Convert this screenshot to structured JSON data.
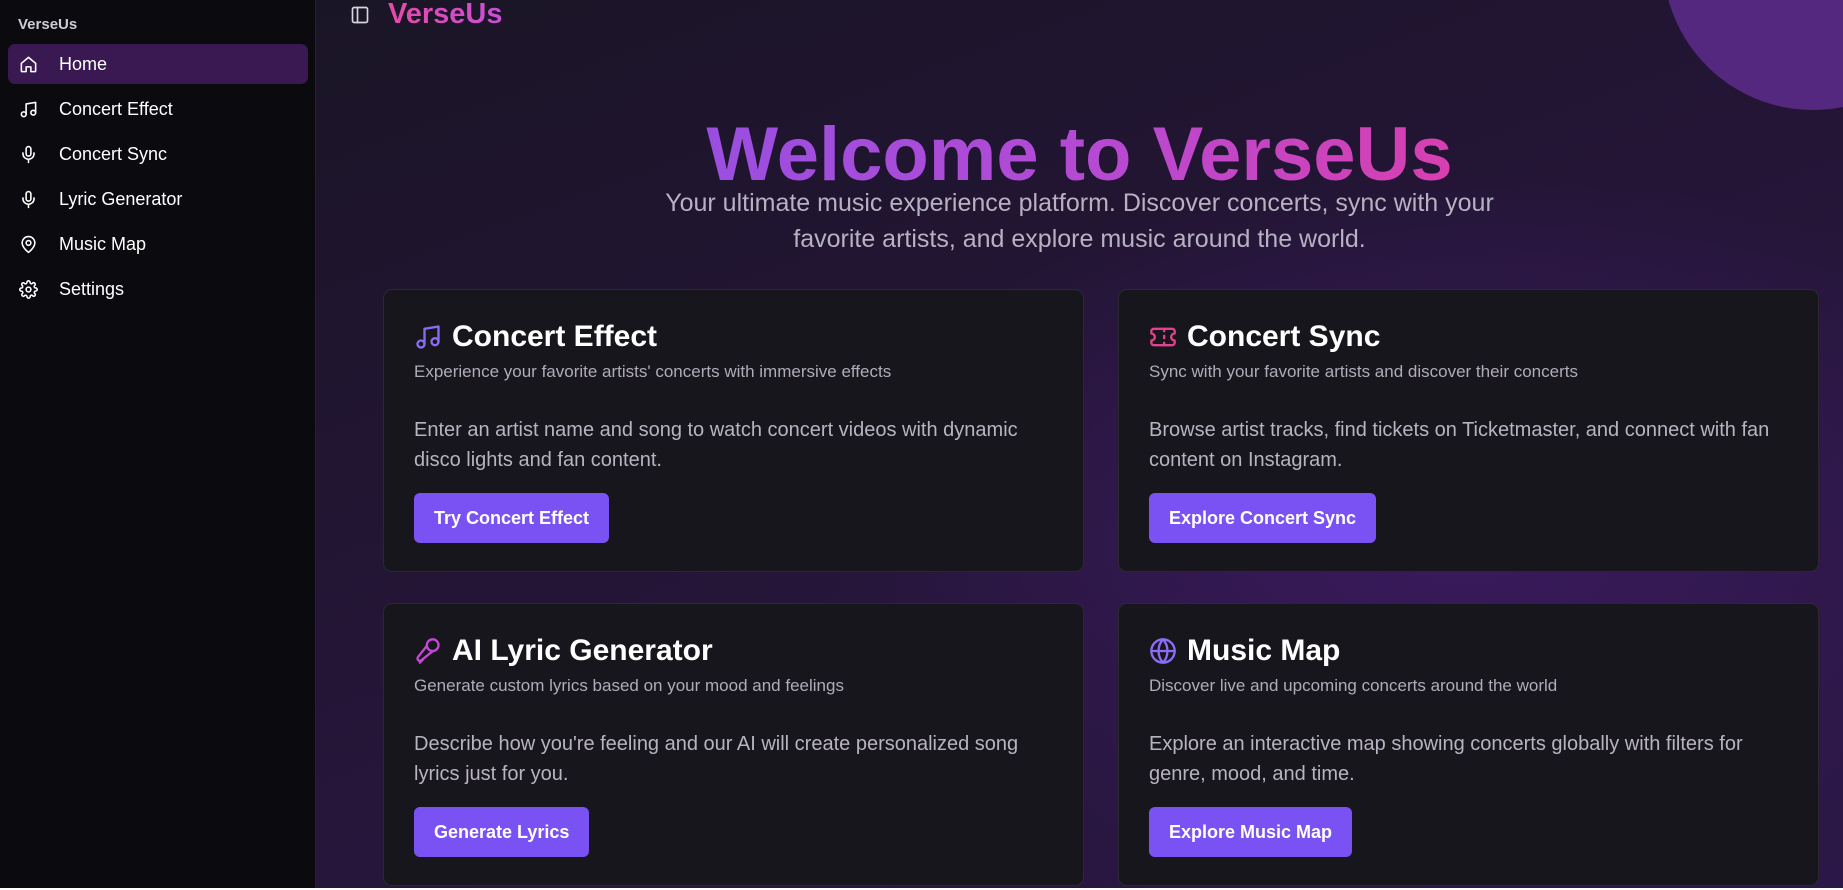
{
  "sidebar": {
    "brand": "VerseUs",
    "items": [
      {
        "label": "Home",
        "icon": "home-icon",
        "active": true
      },
      {
        "label": "Concert Effect",
        "icon": "music-note-icon"
      },
      {
        "label": "Concert Sync",
        "icon": "microphone-icon"
      },
      {
        "label": "Lyric Generator",
        "icon": "microphone-icon"
      },
      {
        "label": "Music Map",
        "icon": "map-pin-icon"
      },
      {
        "label": "Settings",
        "icon": "gear-icon"
      }
    ]
  },
  "header": {
    "brand": "VerseUs",
    "toggle_icon": "sidebar-toggle-icon"
  },
  "hero": {
    "title": "Welcome to VerseUs",
    "subtitle": "Your ultimate music experience platform. Discover concerts, sync with your favorite artists, and explore music around the world."
  },
  "cards": [
    {
      "title": "Concert Effect",
      "subtitle": "Experience your favorite artists' concerts with immersive effects",
      "description": "Enter an artist name and song to watch concert videos with dynamic disco lights and fan content.",
      "button": "Try Concert Effect",
      "icon": "music-note-icon",
      "icon_color": "#8b6cf6"
    },
    {
      "title": "Concert Sync",
      "subtitle": "Sync with your favorite artists and discover their concerts",
      "description": "Browse artist tracks, find tickets on Ticketmaster, and connect with fan content on Instagram.",
      "button": "Explore Concert Sync",
      "icon": "ticket-icon",
      "icon_color": "#e0428f"
    },
    {
      "title": "AI Lyric Generator",
      "subtitle": "Generate custom lyrics based on your mood and feelings",
      "description": "Describe how you're feeling and our AI will create personalized song lyrics just for you.",
      "button": "Generate Lyrics",
      "icon": "mic-vocal-icon",
      "icon_color": "#c448d6"
    },
    {
      "title": "Music Map",
      "subtitle": "Discover live and upcoming concerts around the world",
      "description": "Explore an interactive map showing concerts globally with filters for genre, mood, and time.",
      "button": "Explore Music Map",
      "icon": "globe-icon",
      "icon_color": "#8b6cf6"
    }
  ],
  "colors": {
    "accent": "#7a52f4",
    "brand_pink": "#e54aa8",
    "sidebar_bg": "#0b0a0e",
    "card_bg": "#18161d"
  }
}
